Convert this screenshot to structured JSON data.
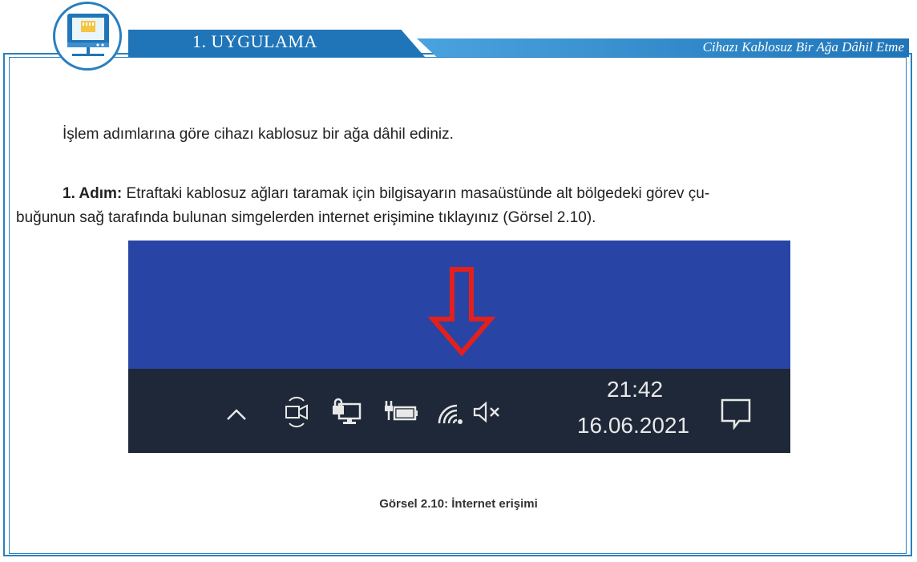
{
  "header": {
    "title": "1. UYGULAMA",
    "subtitle": "Cihazı Kablosuz Bir Ağa Dâhil Etme",
    "badge_icon": "network-computer-icon"
  },
  "intro": "İşlem adımlarına göre cihazı kablosuz bir ağa dâhil ediniz.",
  "step1": {
    "label": "1. Adım:",
    "text_line1": " Etraftaki kablosuz ağları taramak için bilgisayarın masaüstünde alt bölgedeki görev çu-",
    "text_line2": "buğunun sağ tarafında bulunan simgelerden internet erişimine tıklayınız (Görsel 2.10)."
  },
  "figure": {
    "taskbar": {
      "time": "21:42",
      "date": "16.06.2021",
      "icons": [
        "chevron-up-icon",
        "camera-icon",
        "network-lock-icon",
        "battery-plug-icon",
        "wifi-icon",
        "volume-mute-icon",
        "notification-icon"
      ]
    },
    "caption": "Görsel 2.10: İnternet erişimi"
  },
  "colors": {
    "accent": "#1f75b8",
    "desktop": "#2845a6",
    "taskbar": "#1e2838",
    "arrow": "#e3201c"
  }
}
